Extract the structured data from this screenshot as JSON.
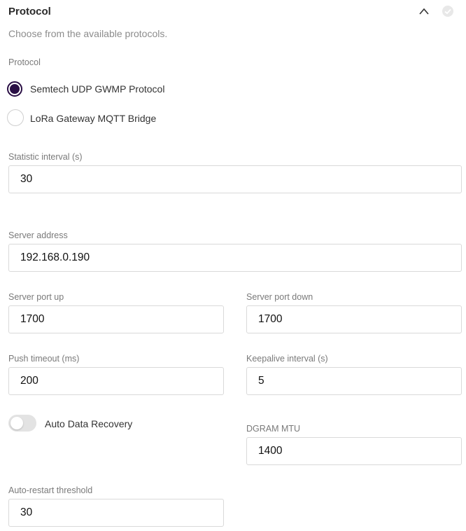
{
  "section": {
    "title": "Protocol",
    "description": "Choose from the available protocols."
  },
  "protocol": {
    "label": "Protocol",
    "options": [
      {
        "label": "Semtech UDP GWMP Protocol",
        "selected": true
      },
      {
        "label": "LoRa Gateway MQTT Bridge",
        "selected": false
      }
    ]
  },
  "fields": {
    "statistic_interval": {
      "label": "Statistic interval (s)",
      "value": "30"
    },
    "server_address": {
      "label": "Server address",
      "value": "192.168.0.190"
    },
    "server_port_up": {
      "label": "Server port up",
      "value": "1700"
    },
    "server_port_down": {
      "label": "Server port down",
      "value": "1700"
    },
    "push_timeout": {
      "label": "Push timeout (ms)",
      "value": "200"
    },
    "keepalive_interval": {
      "label": "Keepalive interval (s)",
      "value": "5"
    },
    "dgram_mtu": {
      "label": "DGRAM MTU",
      "value": "1400"
    },
    "auto_restart_threshold": {
      "label": "Auto-restart threshold",
      "value": "30"
    }
  },
  "auto_data_recovery": {
    "label": "Auto Data Recovery",
    "enabled": false
  },
  "icons": {
    "collapse": "chevron-up-icon",
    "status": "check-circle-icon"
  },
  "colors": {
    "radio_selected": "#2a0f45",
    "border": "#d9d9d9"
  }
}
